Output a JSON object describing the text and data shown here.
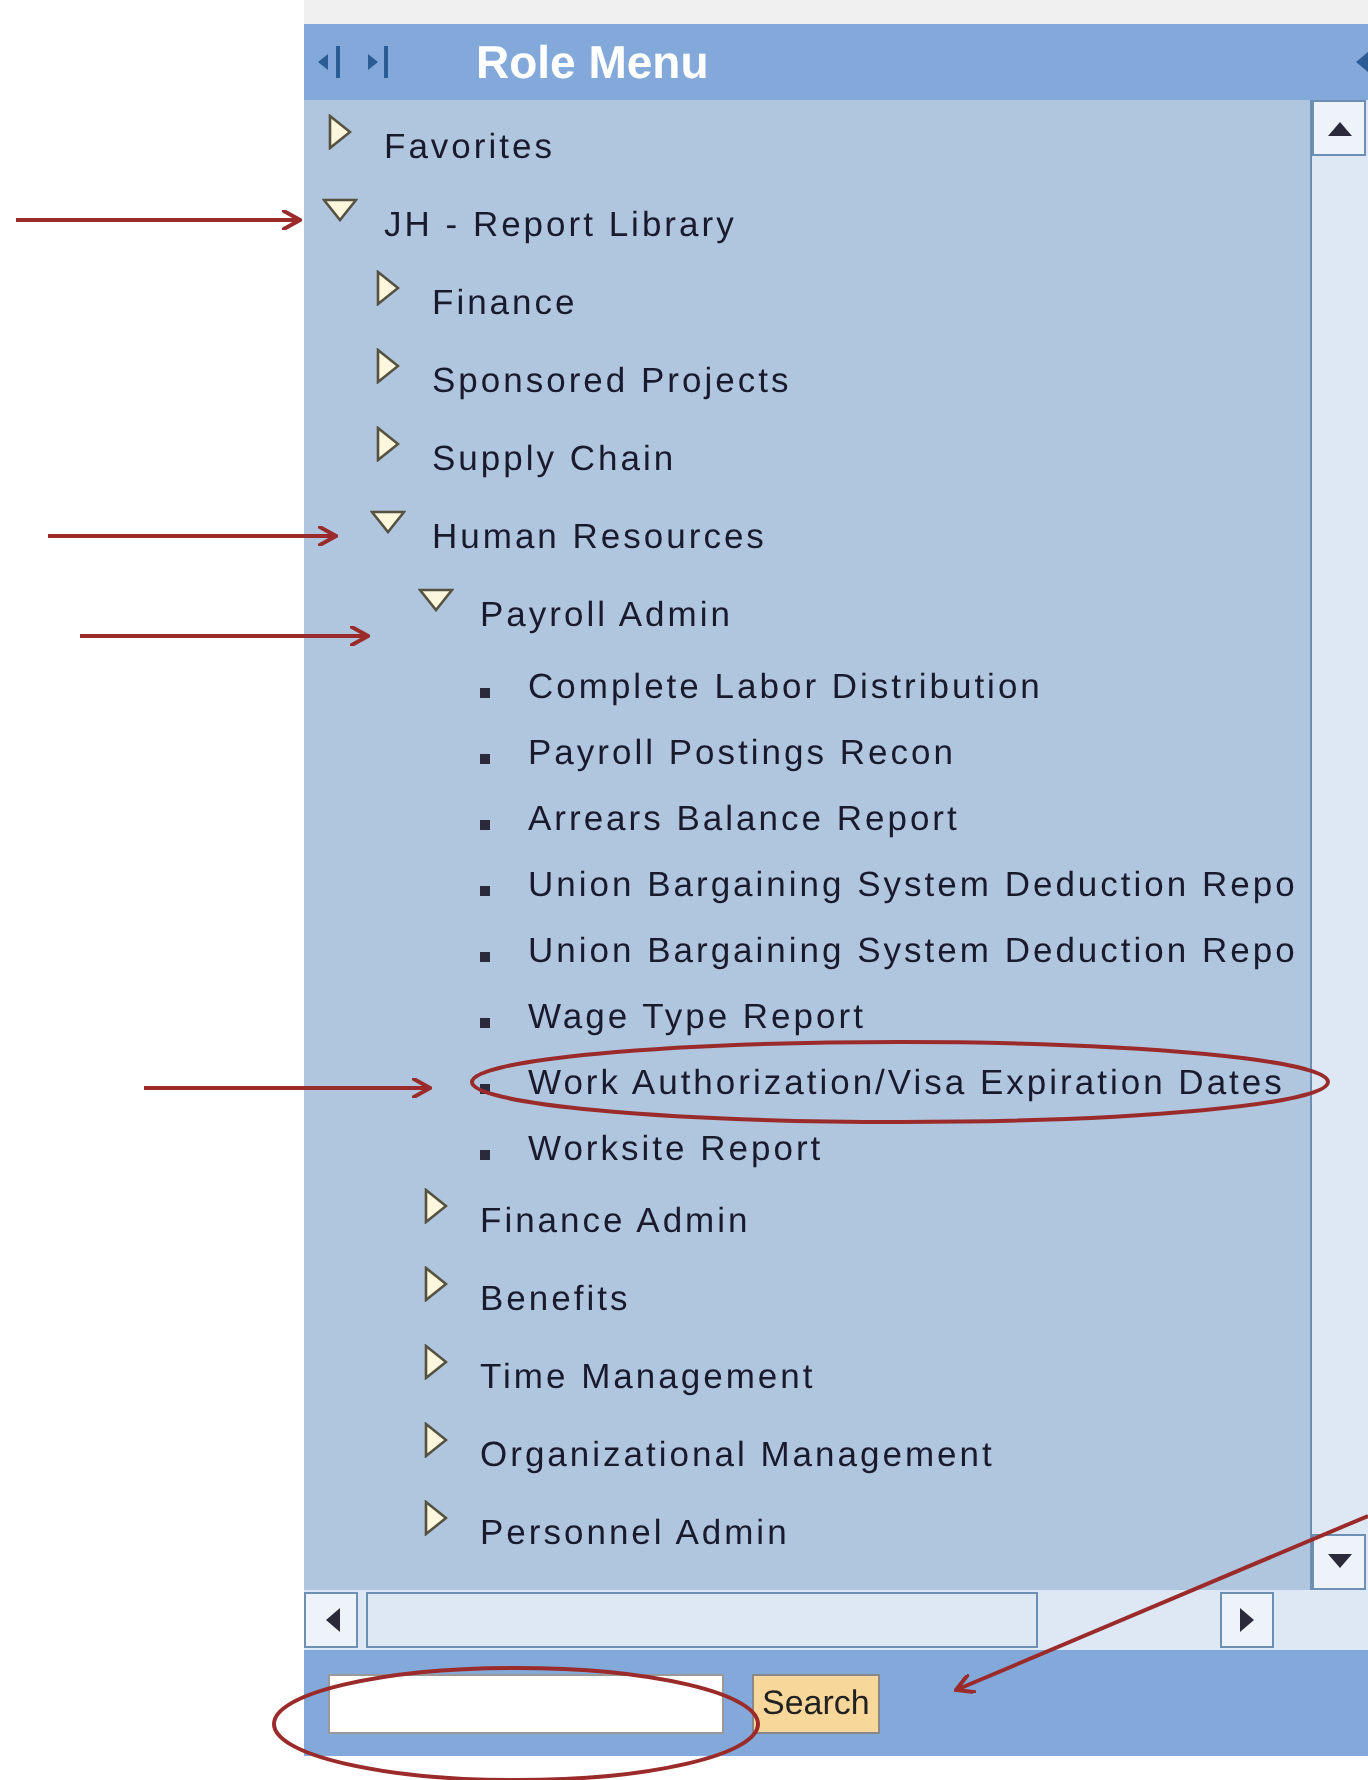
{
  "panel": {
    "title": "Role Menu"
  },
  "tree": [
    {
      "label": "Favorites",
      "kind": "folder",
      "expanded": false
    },
    {
      "label": "JH - Report Library",
      "kind": "folder",
      "expanded": true,
      "children": [
        {
          "label": "Finance",
          "kind": "folder",
          "expanded": false
        },
        {
          "label": "Sponsored Projects",
          "kind": "folder",
          "expanded": false
        },
        {
          "label": "Supply Chain",
          "kind": "folder",
          "expanded": false
        },
        {
          "label": "Human Resources",
          "kind": "folder",
          "expanded": true,
          "children": [
            {
              "label": "Payroll Admin",
              "kind": "folder",
              "expanded": true,
              "children": [
                {
                  "label": "Complete Labor Distribution",
                  "kind": "report"
                },
                {
                  "label": "Payroll Postings Recon",
                  "kind": "report"
                },
                {
                  "label": "Arrears Balance Report",
                  "kind": "report"
                },
                {
                  "label": "Union Bargaining System Deduction Repo",
                  "kind": "report"
                },
                {
                  "label": "Union Bargaining System Deduction Repo",
                  "kind": "report"
                },
                {
                  "label": "Wage Type Report",
                  "kind": "report"
                },
                {
                  "label": "Work Authorization/Visa Expiration Dates",
                  "kind": "report"
                },
                {
                  "label": "Worksite Report",
                  "kind": "report"
                }
              ]
            },
            {
              "label": "Finance Admin",
              "kind": "folder",
              "expanded": false
            },
            {
              "label": "Benefits",
              "kind": "folder",
              "expanded": false
            },
            {
              "label": "Time Management",
              "kind": "folder",
              "expanded": false
            },
            {
              "label": "Organizational Management",
              "kind": "folder",
              "expanded": false
            },
            {
              "label": "Personnel Admin",
              "kind": "folder",
              "expanded": false
            }
          ]
        }
      ]
    }
  ],
  "search": {
    "button": "Search"
  }
}
